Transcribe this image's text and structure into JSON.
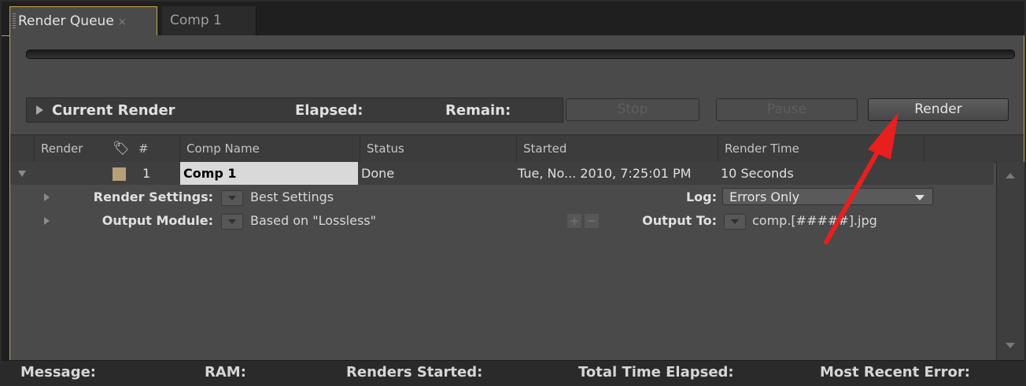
{
  "tabs": [
    {
      "label": "Render Queue",
      "close": "×"
    },
    {
      "label": "Comp 1"
    }
  ],
  "current_render": {
    "label": "Current Render",
    "elapsed_label": "Elapsed:",
    "remain_label": "Remain:"
  },
  "buttons": {
    "stop": "Stop",
    "pause": "Pause",
    "render": "Render"
  },
  "columns": {
    "render": "Render",
    "tag_icon": "tag-icon",
    "number": "#",
    "comp_name": "Comp Name",
    "status": "Status",
    "started": "Started",
    "render_time": "Render Time"
  },
  "queue_item": {
    "number": "1",
    "comp_name": "Comp 1",
    "status": "Done",
    "started": "Tue, No... 2010, 7:25:01 PM",
    "render_time": "10 Seconds",
    "label_color": "#b5a07a",
    "render_settings_label": "Render Settings:",
    "render_settings_value": "Best Settings",
    "log_label": "Log:",
    "log_value": "Errors Only",
    "output_module_label": "Output Module:",
    "output_module_value": "Based on \"Lossless\"",
    "add_symbol": "+",
    "remove_symbol": "−",
    "output_to_label": "Output To:",
    "output_to_value": "comp.[#####].jpg"
  },
  "status_bar": {
    "message": "Message:",
    "ram": "RAM:",
    "renders_started": "Renders Started:",
    "total_time_elapsed": "Total Time Elapsed:",
    "most_recent_error": "Most Recent Error:"
  },
  "colors": {
    "accent_border": "#c7a24a",
    "annotation_arrow": "#e81f1f"
  }
}
